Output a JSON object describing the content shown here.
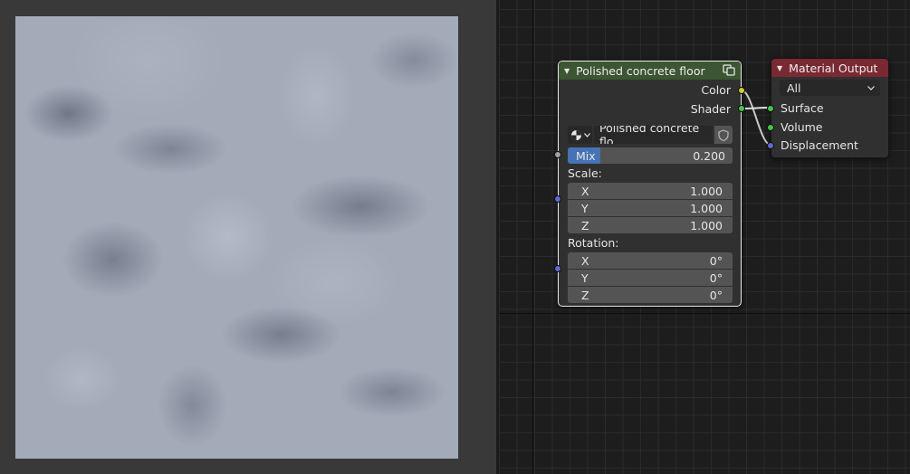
{
  "preview": {
    "description": ""
  },
  "group_node": {
    "title": "Polished concrete floor",
    "outputs": [
      {
        "label": "Color",
        "socket": "yellow"
      },
      {
        "label": "Shader",
        "socket": "green"
      }
    ],
    "datablock_name": "Polished concrete flo...",
    "mix": {
      "label": "Mix",
      "value": "0.200",
      "fraction": 0.2
    },
    "scale": {
      "label": "Scale:",
      "x": {
        "label": "X",
        "value": "1.000"
      },
      "y": {
        "label": "Y",
        "value": "1.000"
      },
      "z": {
        "label": "Z",
        "value": "1.000"
      }
    },
    "rotation": {
      "label": "Rotation:",
      "x": {
        "label": "X",
        "value": "0°"
      },
      "y": {
        "label": "Y",
        "value": "0°"
      },
      "z": {
        "label": "Z",
        "value": "0°"
      }
    }
  },
  "output_node": {
    "title": "Material Output",
    "target": "All",
    "inputs": [
      {
        "label": "Surface",
        "socket": "green"
      },
      {
        "label": "Volume",
        "socket": "green"
      },
      {
        "label": "Displacement",
        "socket": "purple"
      }
    ]
  },
  "colors": {
    "group_header": "#3c5532",
    "output_header": "#7a2831",
    "accent": "#4772b3"
  }
}
